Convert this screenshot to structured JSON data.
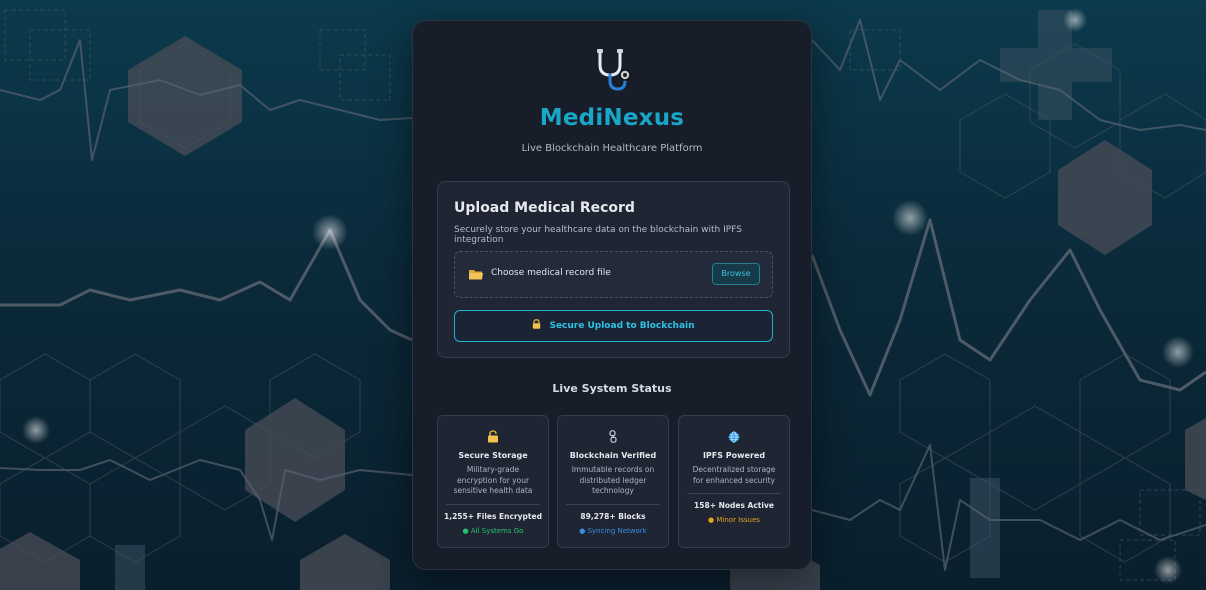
{
  "brand": {
    "name": "MediNexus",
    "tagline": "Live Blockchain Healthcare Platform",
    "logo_icon": "stethoscope-icon"
  },
  "upload": {
    "title": "Upload Medical Record",
    "description": "Securely store your healthcare data on the blockchain with IPFS integration",
    "file_label": "Choose medical record file",
    "file_icon": "folder-icon",
    "browse_label": "Browse",
    "submit_label": "Secure Upload to Blockchain",
    "submit_icon": "lock-icon"
  },
  "status": {
    "title": "Live System Status",
    "tiles": [
      {
        "icon": "lock-icon",
        "title": "Secure Storage",
        "description": "Military-grade encryption for your sensitive health data",
        "metric": "1,255+ Files Encrypted",
        "status": "● All Systems Go",
        "status_color": "#27c26b"
      },
      {
        "icon": "chain-icon",
        "title": "Blockchain Verified",
        "description": "Immutable records on distributed ledger technology",
        "metric": "89,278+ Blocks",
        "status": "● Syncing Network",
        "status_color": "#3a8ee6"
      },
      {
        "icon": "globe-icon",
        "title": "IPFS Powered",
        "description": "Decentralized storage for enhanced security",
        "metric": "158+ Nodes Active",
        "status": "● Minor Issues",
        "status_color": "#e6a61c"
      }
    ]
  },
  "colors": {
    "accent": "#1aa6c7",
    "card_bg": "#181d2a",
    "page_bg": "#0b2a3a"
  }
}
